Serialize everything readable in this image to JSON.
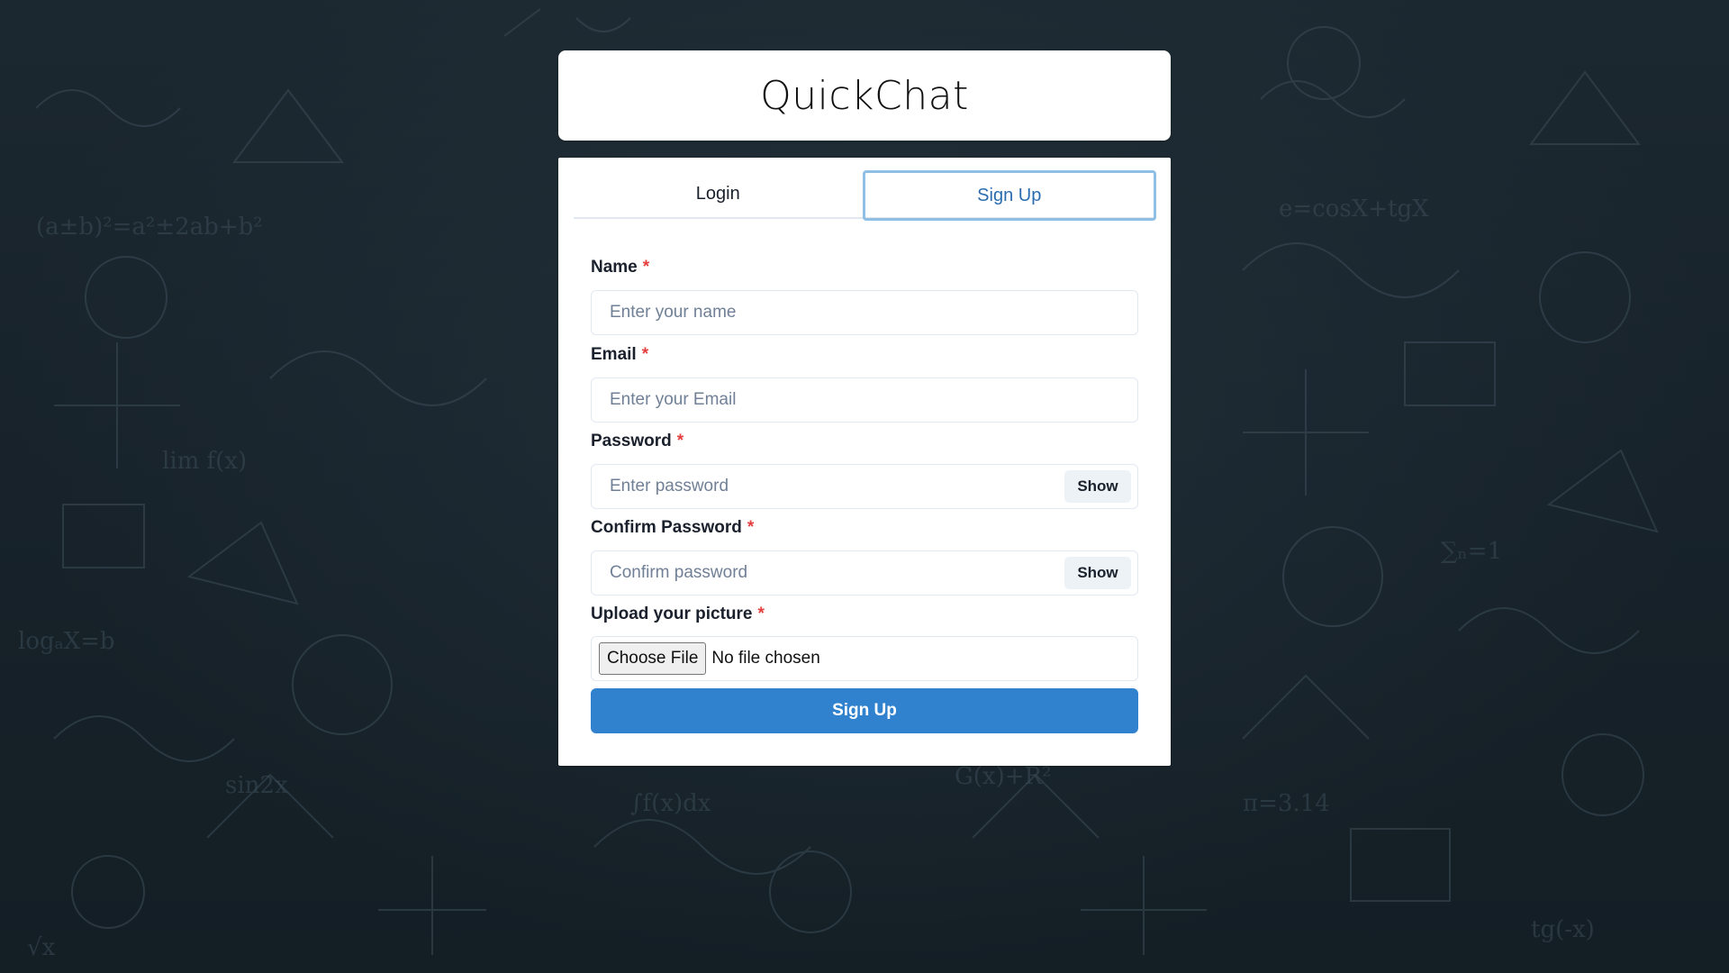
{
  "app": {
    "title": "QuickChat"
  },
  "tabs": [
    {
      "label": "Login",
      "active": false
    },
    {
      "label": "Sign Up",
      "active": true
    }
  ],
  "form": {
    "name": {
      "label": "Name",
      "required_mark": "*",
      "placeholder": "Enter your name",
      "value": ""
    },
    "email": {
      "label": "Email",
      "required_mark": "*",
      "placeholder": "Enter your Email",
      "value": ""
    },
    "password": {
      "label": "Password",
      "required_mark": "*",
      "placeholder": "Enter password",
      "value": "",
      "toggle_label": "Show"
    },
    "confirm_password": {
      "label": "Confirm Password",
      "required_mark": "*",
      "placeholder": "Confirm password",
      "value": "",
      "toggle_label": "Show"
    },
    "picture": {
      "label": "Upload your picture",
      "required_mark": "*",
      "button_label": "Choose File",
      "status": "No file chosen"
    },
    "submit_label": "Sign Up"
  },
  "colors": {
    "accent": "#3182ce",
    "active_tab_text": "#2b6cb0",
    "active_tab_border": "#90bfe6",
    "required": "#e53e3e",
    "background": "#1a252d"
  }
}
